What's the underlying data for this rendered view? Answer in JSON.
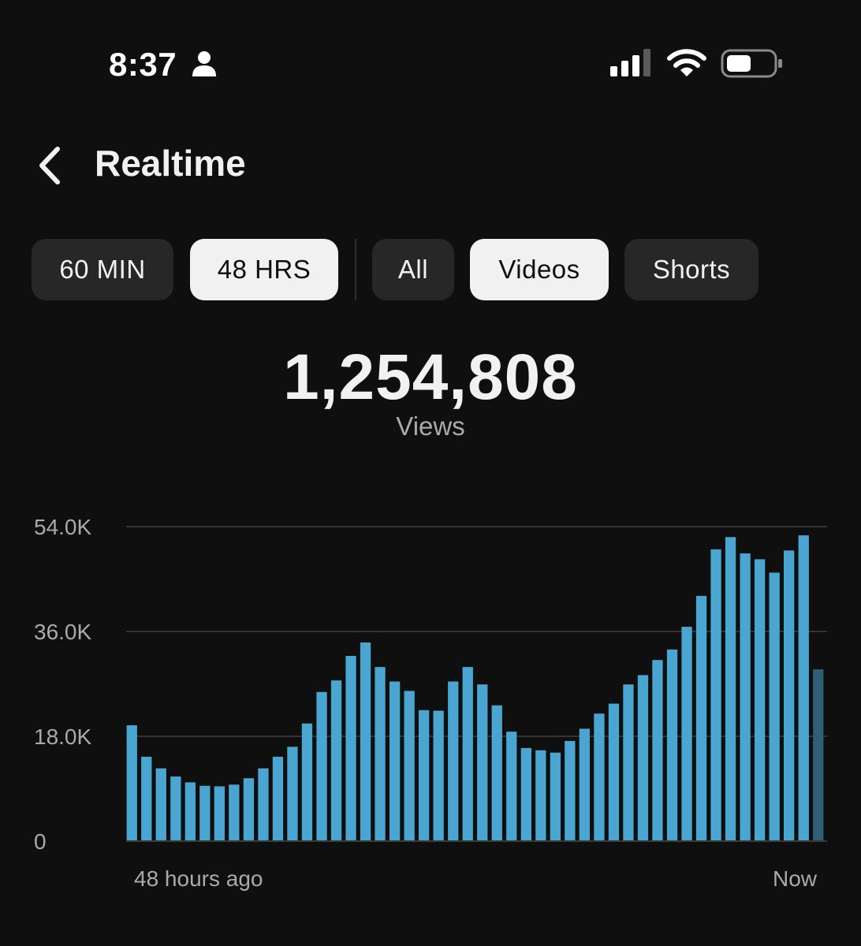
{
  "status_bar": {
    "time": "8:37",
    "icons": [
      "person-icon",
      "signal-icon",
      "wifi-icon",
      "battery-icon"
    ]
  },
  "header": {
    "title": "Realtime",
    "back_icon": "chevron-left-icon"
  },
  "filters": {
    "range": [
      {
        "label": "60 MIN",
        "selected": false
      },
      {
        "label": "48 HRS",
        "selected": true
      }
    ],
    "content": [
      {
        "label": "All",
        "selected": false
      },
      {
        "label": "Videos",
        "selected": true
      },
      {
        "label": "Shorts",
        "selected": false
      }
    ]
  },
  "summary": {
    "value": "1,254,808",
    "label": "Views"
  },
  "colors": {
    "background": "#0f0f0f",
    "bar": "#4aa6d0",
    "bar_current": "#2f5f74",
    "chip_selected": "#f1f1f1",
    "chip": "#272727"
  },
  "chart_data": {
    "type": "bar",
    "ylim": [
      0,
      54000
    ],
    "y_ticks": [
      {
        "value": 0,
        "label": "0"
      },
      {
        "value": 18000,
        "label": "18.0K"
      },
      {
        "value": 36000,
        "label": "36.0K"
      },
      {
        "value": 54000,
        "label": "54.0K"
      }
    ],
    "x_start_label": "48 hours ago",
    "x_end_label": "Now",
    "grid": true,
    "values": [
      19900,
      14500,
      12500,
      11100,
      10100,
      9500,
      9400,
      9700,
      10800,
      12500,
      14500,
      16200,
      20200,
      25600,
      27600,
      31800,
      34100,
      29900,
      27400,
      25800,
      22500,
      22400,
      27400,
      29900,
      26900,
      23300,
      18800,
      16000,
      15600,
      15200,
      17200,
      19300,
      21900,
      23600,
      26900,
      28500,
      31100,
      32900,
      36800,
      42100,
      50100,
      52200,
      49400,
      48400,
      46100,
      49900,
      52500,
      29500
    ],
    "current_partial_index": 47
  }
}
